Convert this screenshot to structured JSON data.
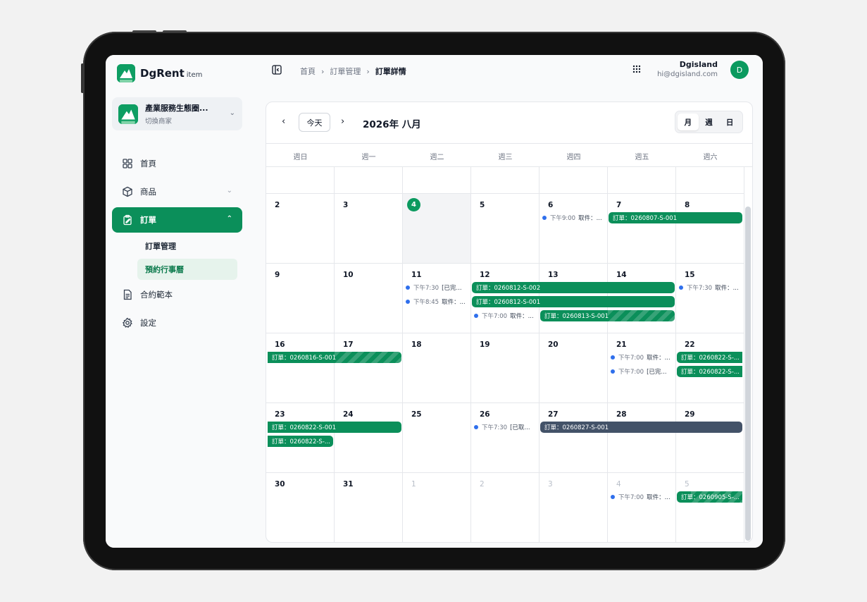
{
  "app": {
    "brand": "DgRent",
    "brand_suffix": "item",
    "accent": "#0b8f5a"
  },
  "merchant": {
    "name": "產業服務生態圈...",
    "subtitle": "切換商家"
  },
  "sidebar": {
    "items": [
      {
        "label": "首頁"
      },
      {
        "label": "商品"
      },
      {
        "label": "訂單"
      },
      {
        "label": "合約範本"
      },
      {
        "label": "設定"
      }
    ],
    "order_sub": [
      {
        "label": "訂單管理"
      },
      {
        "label": "預約行事曆"
      }
    ]
  },
  "breadcrumb": {
    "items": [
      "首頁",
      "訂單管理",
      "訂單詳情"
    ]
  },
  "user": {
    "name": "Dgisland",
    "email": "hi@dgisland.com",
    "initial": "D"
  },
  "calendar": {
    "today_label": "今天",
    "title": "2026年 八月",
    "views": [
      "月",
      "週",
      "日"
    ],
    "weekdays": [
      "週日",
      "週一",
      "週二",
      "週三",
      "週四",
      "週五",
      "週六"
    ],
    "days": {
      "r1": [
        "2",
        "3",
        "4",
        "5",
        "6",
        "7",
        "8"
      ],
      "r2": [
        "9",
        "10",
        "11",
        "12",
        "13",
        "14",
        "15"
      ],
      "r3": [
        "16",
        "17",
        "18",
        "19",
        "20",
        "21",
        "22"
      ],
      "r4": [
        "23",
        "24",
        "25",
        "26",
        "27",
        "28",
        "29"
      ],
      "r5": [
        "30",
        "31",
        "1",
        "2",
        "3",
        "4",
        "5"
      ]
    },
    "events": {
      "e6a_time": "下午9:00",
      "e6a_text": "取件：...",
      "b7": "訂單：0260807-S-001",
      "e11a_time": "下午7:30",
      "e11a_text": "[已完...",
      "e11b_time": "下午8:45",
      "e11b_text": "取件：...",
      "b12a": "訂單：0260812-S-002",
      "b12b": "訂單：0260812-S-001",
      "e12c_time": "下午7:00",
      "e12c_text": "取件：...",
      "b13": "訂單：0260813-S-001",
      "e15_time": "下午7:30",
      "e15_text": "取件：...",
      "b16": "訂單：0260816-S-001",
      "e21a_time": "下午7:00",
      "e21a_text": "取件：...",
      "e21b_time": "下午7:00",
      "e21b_text": "[已完...",
      "b22a": "訂單：0260822-S-...",
      "b22b": "訂單：0260822-S-...",
      "b23a": "訂單：0260822-S-001",
      "b23b": "訂單：0260822-S-...",
      "e26_time": "下午7:30",
      "e26_text": "[已取...",
      "b27": "訂單：0260827-S-001",
      "e4s_time": "下午7:00",
      "e4s_text": "取件：...",
      "b5s": "訂單：0260905-S-..."
    }
  }
}
